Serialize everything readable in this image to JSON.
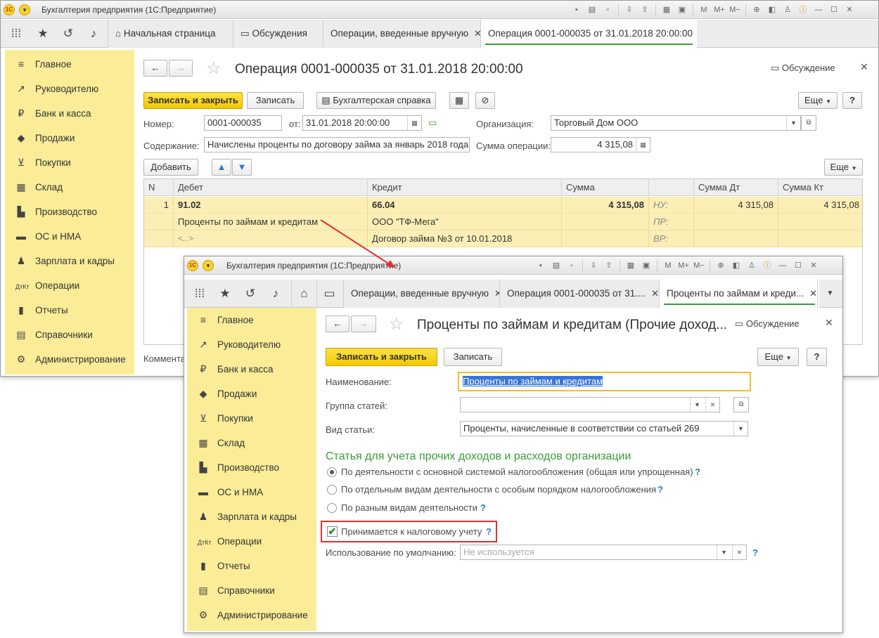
{
  "main_window": {
    "title": "Бухгалтерия предприятия  (1С:Предприятие)",
    "tabs": [
      {
        "label": "Начальная страница"
      },
      {
        "label": "Обсуждения"
      },
      {
        "label": "Операции, введенные вручную"
      },
      {
        "label": "Операция 0001-000035 от 31.01.2018 20:00:00"
      }
    ],
    "sidebar": [
      {
        "label": "Главное",
        "icon": "menu-icon"
      },
      {
        "label": "Руководителю",
        "icon": "trend-icon"
      },
      {
        "label": "Банк и касса",
        "icon": "ruble-icon"
      },
      {
        "label": "Продажи",
        "icon": "bag-icon"
      },
      {
        "label": "Покупки",
        "icon": "cart-icon"
      },
      {
        "label": "Склад",
        "icon": "warehouse-icon"
      },
      {
        "label": "Производство",
        "icon": "factory-icon"
      },
      {
        "label": "ОС и НМА",
        "icon": "truck-icon"
      },
      {
        "label": "Зарплата и кадры",
        "icon": "person-icon"
      },
      {
        "label": "Операции",
        "icon": "dt-kt-icon"
      },
      {
        "label": "Отчеты",
        "icon": "bar-chart-icon"
      },
      {
        "label": "Справочники",
        "icon": "books-icon"
      },
      {
        "label": "Администрирование",
        "icon": "gear-icon"
      }
    ],
    "form": {
      "title": "Операция 0001-000035 от 31.01.2018 20:00:00",
      "discussion": "Обсуждение",
      "btn_save_close": "Записать и закрыть",
      "btn_save": "Записать",
      "btn_report": "Бухгалтерская справка",
      "btn_more": "Еще",
      "btn_help": "?",
      "number_label": "Номер:",
      "number_value": "0001-000035",
      "date_label": "от:",
      "date_value": "31.01.2018 20:00:00",
      "org_label": "Организация:",
      "org_value": "Торговый Дом ООО",
      "content_label": "Содержание:",
      "content_value": "Начислены проценты по договору займа за январь 2018 года",
      "sum_label": "Сумма операции:",
      "sum_value": "4 315,08",
      "btn_add": "Добавить",
      "comment_label": "Коммента"
    },
    "table": {
      "headers": [
        "N",
        "Дебет",
        "Кредит",
        "Сумма",
        "",
        "Сумма Дт",
        "Сумма Кт"
      ],
      "row": {
        "n": "1",
        "debit": "91.02",
        "debit_sub1": "Проценты по займам и кредитам",
        "debit_sub2": "<...>",
        "credit": "66.04",
        "credit_sub1": "ООО \"ТФ-Мега\"",
        "credit_sub2": "Договор займа №3 от 10.01.2018",
        "sum": "4 315,08",
        "nu": "НУ:",
        "pr": "ПР:",
        "vr": "ВР:",
        "sum_dt": "4 315,08",
        "sum_kt": "4 315,08"
      }
    }
  },
  "second_window": {
    "title": "Бухгалтерия предприятия  (1С:Предприятие)",
    "tabs": [
      {
        "label": "Операции, введенные вручную"
      },
      {
        "label": "Операция 0001-000035 от 31...."
      },
      {
        "label": "Проценты по займам и креди..."
      }
    ],
    "form": {
      "title": "Проценты по займам и кредитам (Прочие доход...",
      "discussion": "Обсуждение",
      "btn_save_close": "Записать и закрыть",
      "btn_save": "Записать",
      "btn_more": "Еще",
      "btn_help": "?",
      "name_label": "Наименование:",
      "name_value": "Проценты по займам и кредитам",
      "group_label": "Группа статей:",
      "group_value": "",
      "kind_label": "Вид статьи:",
      "kind_value": "Проценты, начисленные в соответствии со статьей 269",
      "section_title": "Статья для учета прочих доходов и расходов организации",
      "radios": [
        {
          "label": "По деятельности с основной системой налогообложения (общая или упрощенная)",
          "checked": true
        },
        {
          "label": "По отдельным видам деятельности с особым порядком налогообложения",
          "checked": false
        },
        {
          "label": "По разным видам деятельности",
          "checked": false
        }
      ],
      "checkbox_label": "Принимается к налоговому учету",
      "checkbox_checked": true,
      "default_label": "Использование по умолчанию:",
      "default_placeholder": "Не используется",
      "help_mark": "?"
    }
  },
  "colors": {
    "accent_green": "#3a9b3a",
    "sidebar_yellow": "#fbec98",
    "highlight_red": "#e03030"
  }
}
